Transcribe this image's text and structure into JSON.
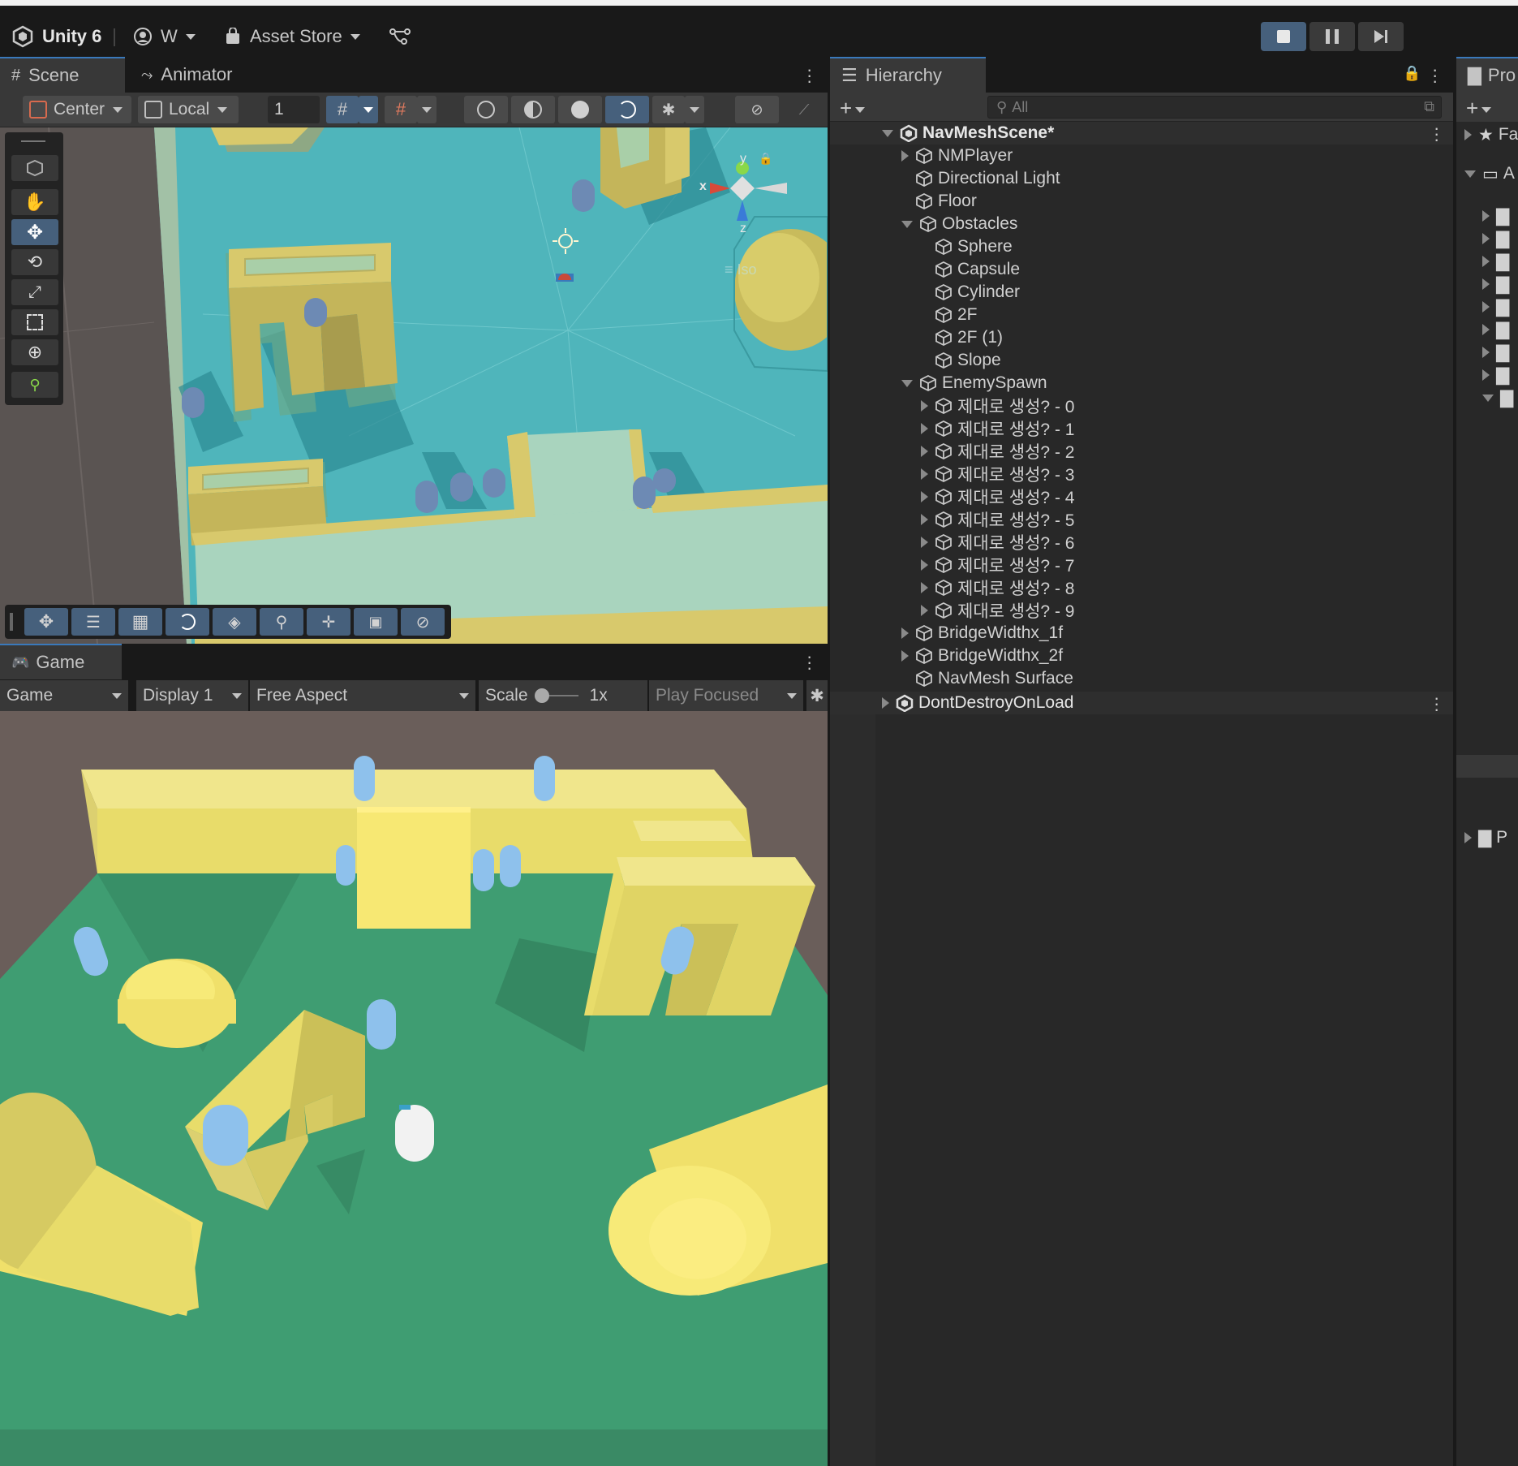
{
  "topbar": {
    "app_name": "Unity 6",
    "account": "W",
    "asset_store": "Asset Store",
    "play_controls": [
      "stop",
      "pause",
      "step"
    ]
  },
  "scene_panel": {
    "tabs": [
      {
        "label": "Scene",
        "active": true
      },
      {
        "label": "Animator",
        "active": false
      }
    ],
    "toolbar": {
      "pivot": "Center",
      "space": "Local",
      "grid_size": "1"
    },
    "gizmo": {
      "x_label": "x",
      "y_label": "y",
      "z_label": "z",
      "projection": "Iso"
    }
  },
  "game_panel": {
    "tab": "Game",
    "mode": "Game",
    "display": "Display 1",
    "aspect": "Free Aspect",
    "scale_label": "Scale",
    "scale_value": "1x",
    "play_mode": "Play Focused"
  },
  "hierarchy": {
    "tab": "Hierarchy",
    "search_placeholder": "All",
    "scene": "NavMeshScene*",
    "rows": [
      {
        "label": "NMPlayer",
        "arrow": "collapsed",
        "depth": 1
      },
      {
        "label": "Directional Light",
        "arrow": "none",
        "depth": 1
      },
      {
        "label": "Floor",
        "arrow": "none",
        "depth": 1
      },
      {
        "label": "Obstacles",
        "arrow": "expanded",
        "depth": 1
      },
      {
        "label": "Sphere",
        "arrow": "none",
        "depth": 2
      },
      {
        "label": "Capsule",
        "arrow": "none",
        "depth": 2
      },
      {
        "label": "Cylinder",
        "arrow": "none",
        "depth": 2
      },
      {
        "label": "2F",
        "arrow": "none",
        "depth": 2
      },
      {
        "label": "2F (1)",
        "arrow": "none",
        "depth": 2
      },
      {
        "label": "Slope",
        "arrow": "none",
        "depth": 2
      },
      {
        "label": "EnemySpawn",
        "arrow": "expanded",
        "depth": 1
      },
      {
        "label": "제대로 생성? - 0",
        "arrow": "collapsed",
        "depth": 2
      },
      {
        "label": "제대로 생성? - 1",
        "arrow": "collapsed",
        "depth": 2
      },
      {
        "label": "제대로 생성? - 2",
        "arrow": "collapsed",
        "depth": 2
      },
      {
        "label": "제대로 생성? - 3",
        "arrow": "collapsed",
        "depth": 2
      },
      {
        "label": "제대로 생성? - 4",
        "arrow": "collapsed",
        "depth": 2
      },
      {
        "label": "제대로 생성? - 5",
        "arrow": "collapsed",
        "depth": 2
      },
      {
        "label": "제대로 생성? - 6",
        "arrow": "collapsed",
        "depth": 2
      },
      {
        "label": "제대로 생성? - 7",
        "arrow": "collapsed",
        "depth": 2
      },
      {
        "label": "제대로 생성? - 8",
        "arrow": "collapsed",
        "depth": 2
      },
      {
        "label": "제대로 생성? - 9",
        "arrow": "collapsed",
        "depth": 2
      },
      {
        "label": "BridgeWidthx_1f",
        "arrow": "collapsed",
        "depth": 1
      },
      {
        "label": "BridgeWidthx_2f",
        "arrow": "collapsed",
        "depth": 1
      },
      {
        "label": "NavMesh Surface",
        "arrow": "none",
        "depth": 1
      }
    ],
    "dont_destroy": "DontDestroyOnLoad"
  },
  "project_panel": {
    "tab": "Pro",
    "rows": [
      {
        "label": "Fa",
        "arrow": "collapsed",
        "icon": "star"
      },
      {
        "label": "A",
        "arrow": "expanded",
        "icon": "folder-open"
      },
      {
        "label": "P",
        "arrow": "collapsed",
        "icon": "folder"
      }
    ]
  },
  "colors": {
    "accent": "#3a79bb",
    "selected_tool": "#46607c",
    "scene_floor": "#4fb5bb",
    "game_floor": "#3f9d72",
    "obstacle_yellow": "#e8dc6a",
    "agent_blue": "#8ec1ec"
  }
}
